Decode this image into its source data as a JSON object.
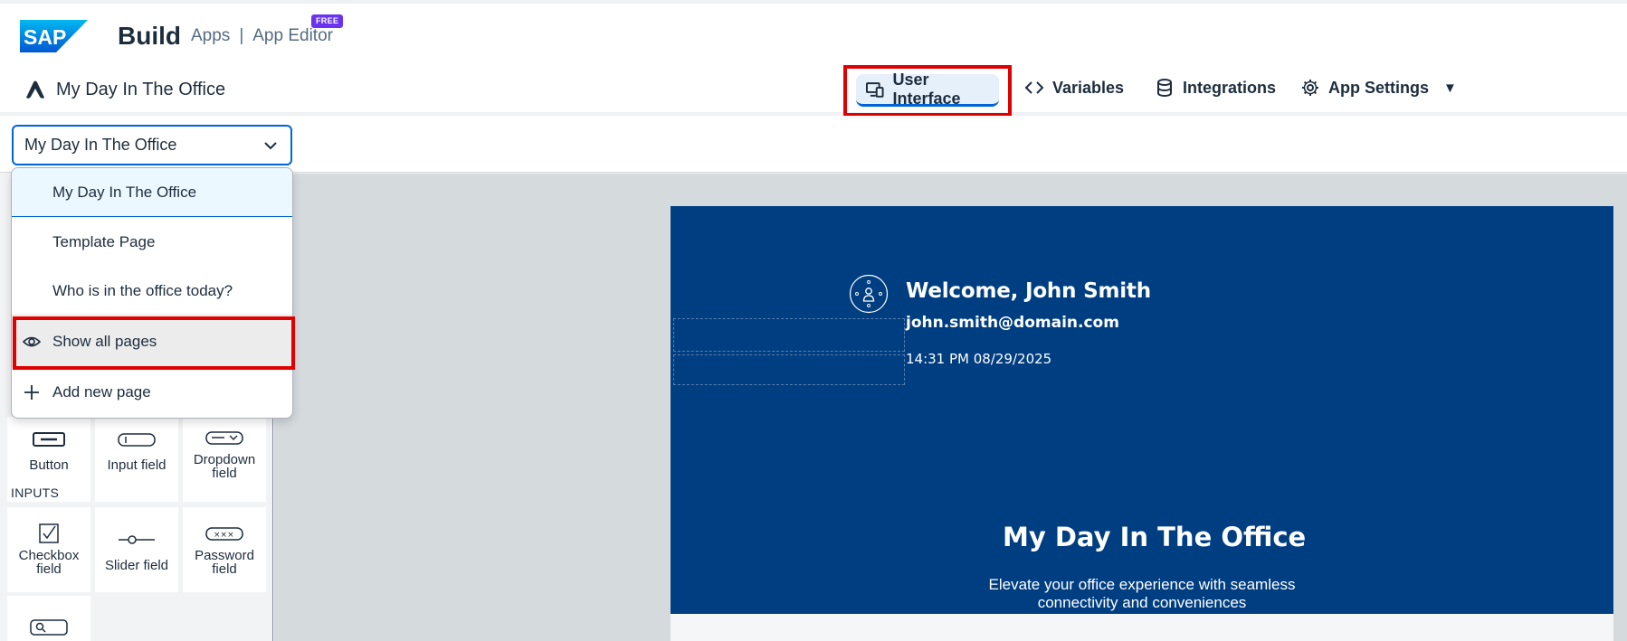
{
  "header": {
    "brand": "SAP",
    "product": "Build",
    "breadcrumb": [
      "Apps",
      "App Editor"
    ],
    "breadcrumb_separator": "|",
    "badge": "FREE",
    "project_name": "My Day In The Office"
  },
  "nav": {
    "user_interface": "User Interface",
    "variables": "Variables",
    "integrations": "Integrations",
    "app_settings": "App Settings",
    "active": "User Interface"
  },
  "page_select": {
    "value": "My Day In The Office"
  },
  "page_menu": {
    "items": [
      {
        "label": "My Day In The Office",
        "selected": true
      },
      {
        "label": "Template Page",
        "selected": false
      },
      {
        "label": "Who is in the office today?",
        "selected": false
      }
    ],
    "show_all": "Show all pages",
    "add_new": "Add new page"
  },
  "palette": {
    "row1": [
      {
        "label": "Button",
        "icon": "button-icon"
      },
      {
        "label": "Input field",
        "icon": "input-field-icon"
      },
      {
        "label": "Dropdown field",
        "icon": "dropdown-field-icon"
      }
    ],
    "inputs_label": "INPUTS",
    "row2": [
      {
        "label": "Checkbox field",
        "icon": "checkbox-icon"
      },
      {
        "label": "Slider field",
        "icon": "slider-icon"
      },
      {
        "label": "Password field",
        "icon": "password-icon"
      }
    ],
    "row3": [
      {
        "label": "",
        "icon": "search-field-icon"
      }
    ]
  },
  "canvas": {
    "welcome": "Welcome, John Smith",
    "email": "john.smith@domain.com",
    "timestamp": "14:31 PM 08/29/2025",
    "title": "My Day In The Office",
    "subtitle": "Elevate your office experience with seamless connectivity and conveniences"
  },
  "colors": {
    "accent": "#0064d9",
    "app_background": "#003e82",
    "highlight": "#e00000",
    "badge": "#6b32f0"
  }
}
